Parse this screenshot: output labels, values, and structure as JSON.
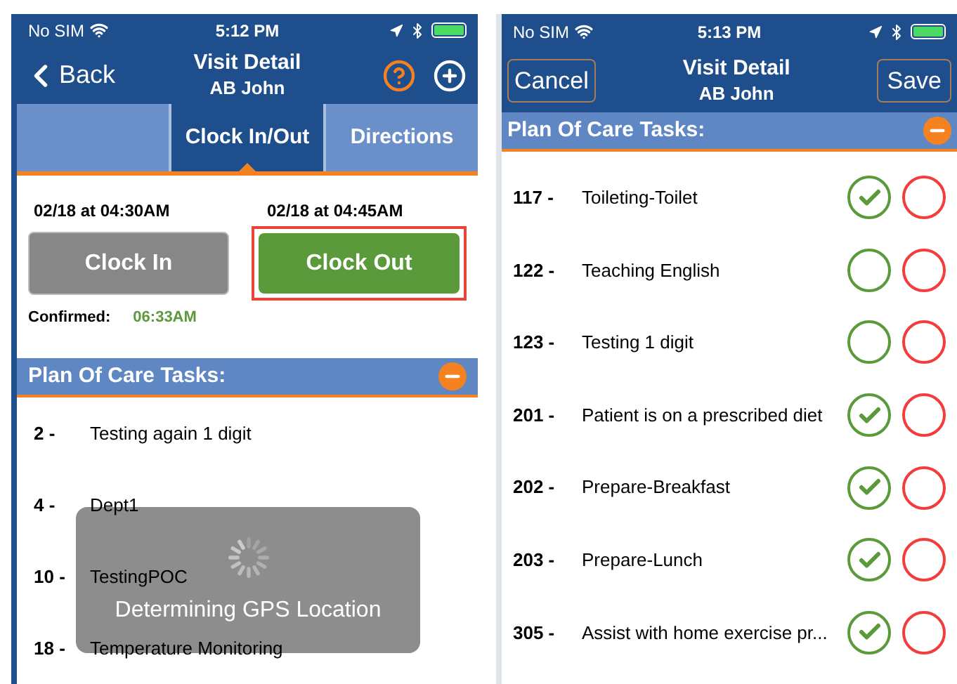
{
  "left_screen": {
    "status_bar": {
      "carrier": "No SIM",
      "time": "5:12 PM"
    },
    "nav": {
      "back": "Back",
      "title": "Visit Detail",
      "subtitle": "AB John"
    },
    "tabs": [
      {
        "label": "Clock In/Out",
        "selected": true
      },
      {
        "label": "Directions",
        "selected": false
      }
    ],
    "clock": {
      "in_time": "02/18 at 04:30AM",
      "out_time": "02/18 at 04:45AM",
      "clock_in": "Clock In",
      "clock_out": "Clock Out",
      "confirmed_label": "Confirmed:",
      "confirmed_time": "06:33AM"
    },
    "section_title": "Plan Of Care Tasks:",
    "tasks": [
      {
        "number": "2 -",
        "name": "Testing again 1 digit"
      },
      {
        "number": "4 -",
        "name": "Dept1"
      },
      {
        "number": "10 -",
        "name": "TestingPOC"
      },
      {
        "number": "18 -",
        "name": "Temperature Monitoring"
      }
    ],
    "hud": {
      "message": "Determining GPS Location"
    }
  },
  "right_screen": {
    "status_bar": {
      "carrier": "No SIM",
      "time": "5:13 PM"
    },
    "nav": {
      "cancel": "Cancel",
      "title": "Visit Detail",
      "subtitle": "AB John",
      "save": "Save"
    },
    "section_title": "Plan Of Care Tasks:",
    "tasks": [
      {
        "number": "117 -",
        "name": "Toileting-Toilet",
        "done": true
      },
      {
        "number": "122 -",
        "name": "Teaching English",
        "done": false
      },
      {
        "number": "123 -",
        "name": "Testing 1 digit",
        "done": false
      },
      {
        "number": "201 -",
        "name": "Patient is on a prescribed diet",
        "done": true
      },
      {
        "number": "202 -",
        "name": "Prepare-Breakfast",
        "done": true
      },
      {
        "number": "203 -",
        "name": "Prepare-Lunch",
        "done": true
      },
      {
        "number": "305 -",
        "name": "Assist with home exercise pr...",
        "done": true
      }
    ]
  }
}
